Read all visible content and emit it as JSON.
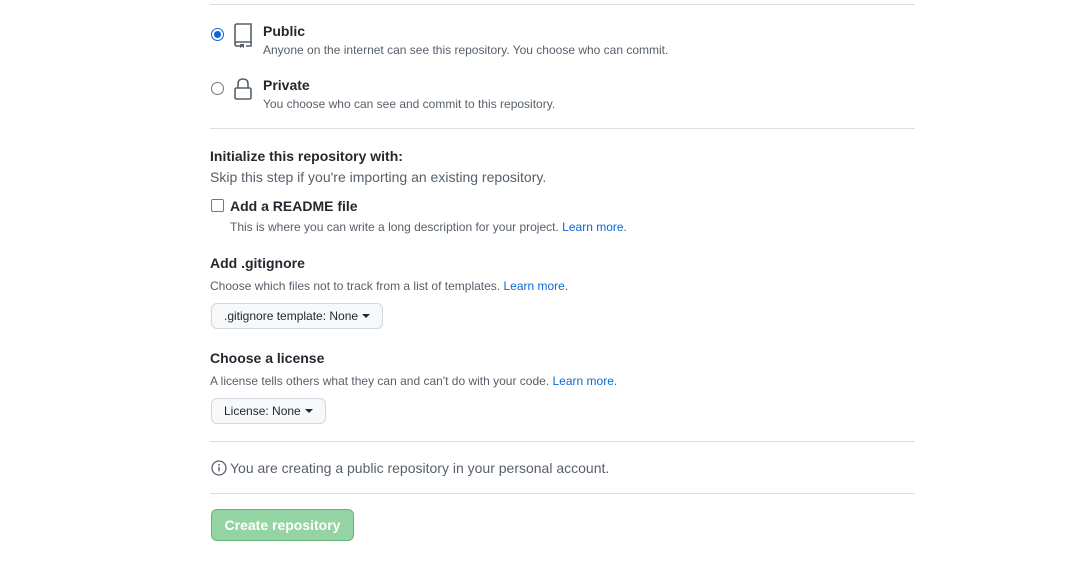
{
  "visibility": {
    "options": [
      {
        "title": "Public",
        "description": "Anyone on the internet can see this repository. You choose who can commit.",
        "icon": "repo-icon",
        "selected": true
      },
      {
        "title": "Private",
        "description": "You choose who can see and commit to this repository.",
        "icon": "lock-icon",
        "selected": false
      }
    ]
  },
  "init": {
    "heading": "Initialize this repository with:",
    "note": "Skip this step if you're importing an existing repository.",
    "readme_label": "Add a README file",
    "readme_checked": false,
    "readme_desc": "This is where you can write a long description for your project.",
    "readme_link": "Learn more."
  },
  "gitignore": {
    "heading": "Add .gitignore",
    "desc": "Choose which files not to track from a list of templates.",
    "link": "Learn more.",
    "select_label": ".gitignore template: None"
  },
  "license": {
    "heading": "Choose a license",
    "desc": "A license tells others what they can and can't do with your code.",
    "link": "Learn more.",
    "select_label": "License: None"
  },
  "info": {
    "icon": "info-icon",
    "text": "You are creating a public repository in your personal account."
  },
  "actions": {
    "create_label": "Create repository",
    "create_color": "#94d3a2"
  },
  "colors": {
    "accent": "#0969da",
    "muted_text": "#57606a",
    "border": "#d8dee4"
  }
}
